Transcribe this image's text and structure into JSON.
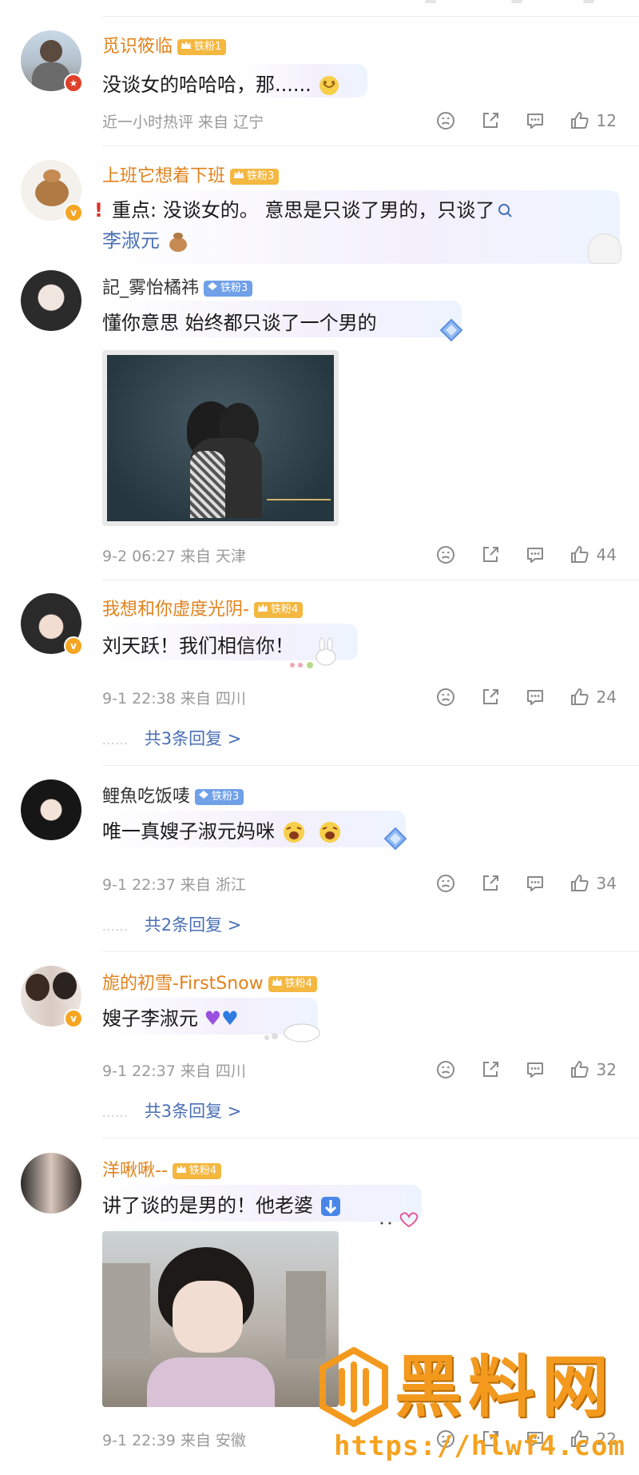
{
  "comments": [
    {
      "username": "觅识筱临",
      "fan_badge": "铁粉1",
      "text": "没谈女的哈哈哈，那......",
      "meta": "近一小时热评  来自 辽宁",
      "likes": "12"
    },
    {
      "username": "上班它想着下班",
      "fan_badge": "铁粉3",
      "text_prefix": "重点: 没谈女的。 意思是只谈了男的，只谈了",
      "text_link": "李淑元"
    },
    {
      "username": "記_雾怡橘祎",
      "fan_badge": "铁粉3",
      "text": "懂你意思 始终都只谈了一个男的",
      "meta": "9-2 06:27  来自 天津",
      "likes": "44"
    },
    {
      "username": "我想和你虚度光阴-",
      "fan_badge": "铁粉4",
      "text": "刘天跃！我们相信你！",
      "meta": "9-1 22:38  来自 四川",
      "likes": "24",
      "replies": "共3条回复 >"
    },
    {
      "username": "鲤魚吃饭唛",
      "fan_badge": "铁粉3",
      "text": "唯一真嫂子淑元妈咪",
      "meta": "9-1 22:37  来自 浙江",
      "likes": "34",
      "replies": "共2条回复 >"
    },
    {
      "username": "旎的初雪-FirstSnow",
      "fan_badge": "铁粉4",
      "text": "嫂子李淑元",
      "meta": "9-1 22:37  来自 四川",
      "likes": "32",
      "replies": "共3条回复 >"
    },
    {
      "username": "洋啾啾--",
      "fan_badge": "铁粉4",
      "text": "讲了谈的是男的！他老婆",
      "meta": "9-1 22:39  来自 安徽",
      "likes": "22"
    }
  ],
  "watermark": {
    "brand": "黑料网",
    "url": "https://hlwf4.com"
  },
  "colors": {
    "username_gold": "#e1821c",
    "reply_link": "#4a6fb5",
    "meta_gray": "#9a9a9a",
    "watermark_orange": "#f39a1e"
  }
}
